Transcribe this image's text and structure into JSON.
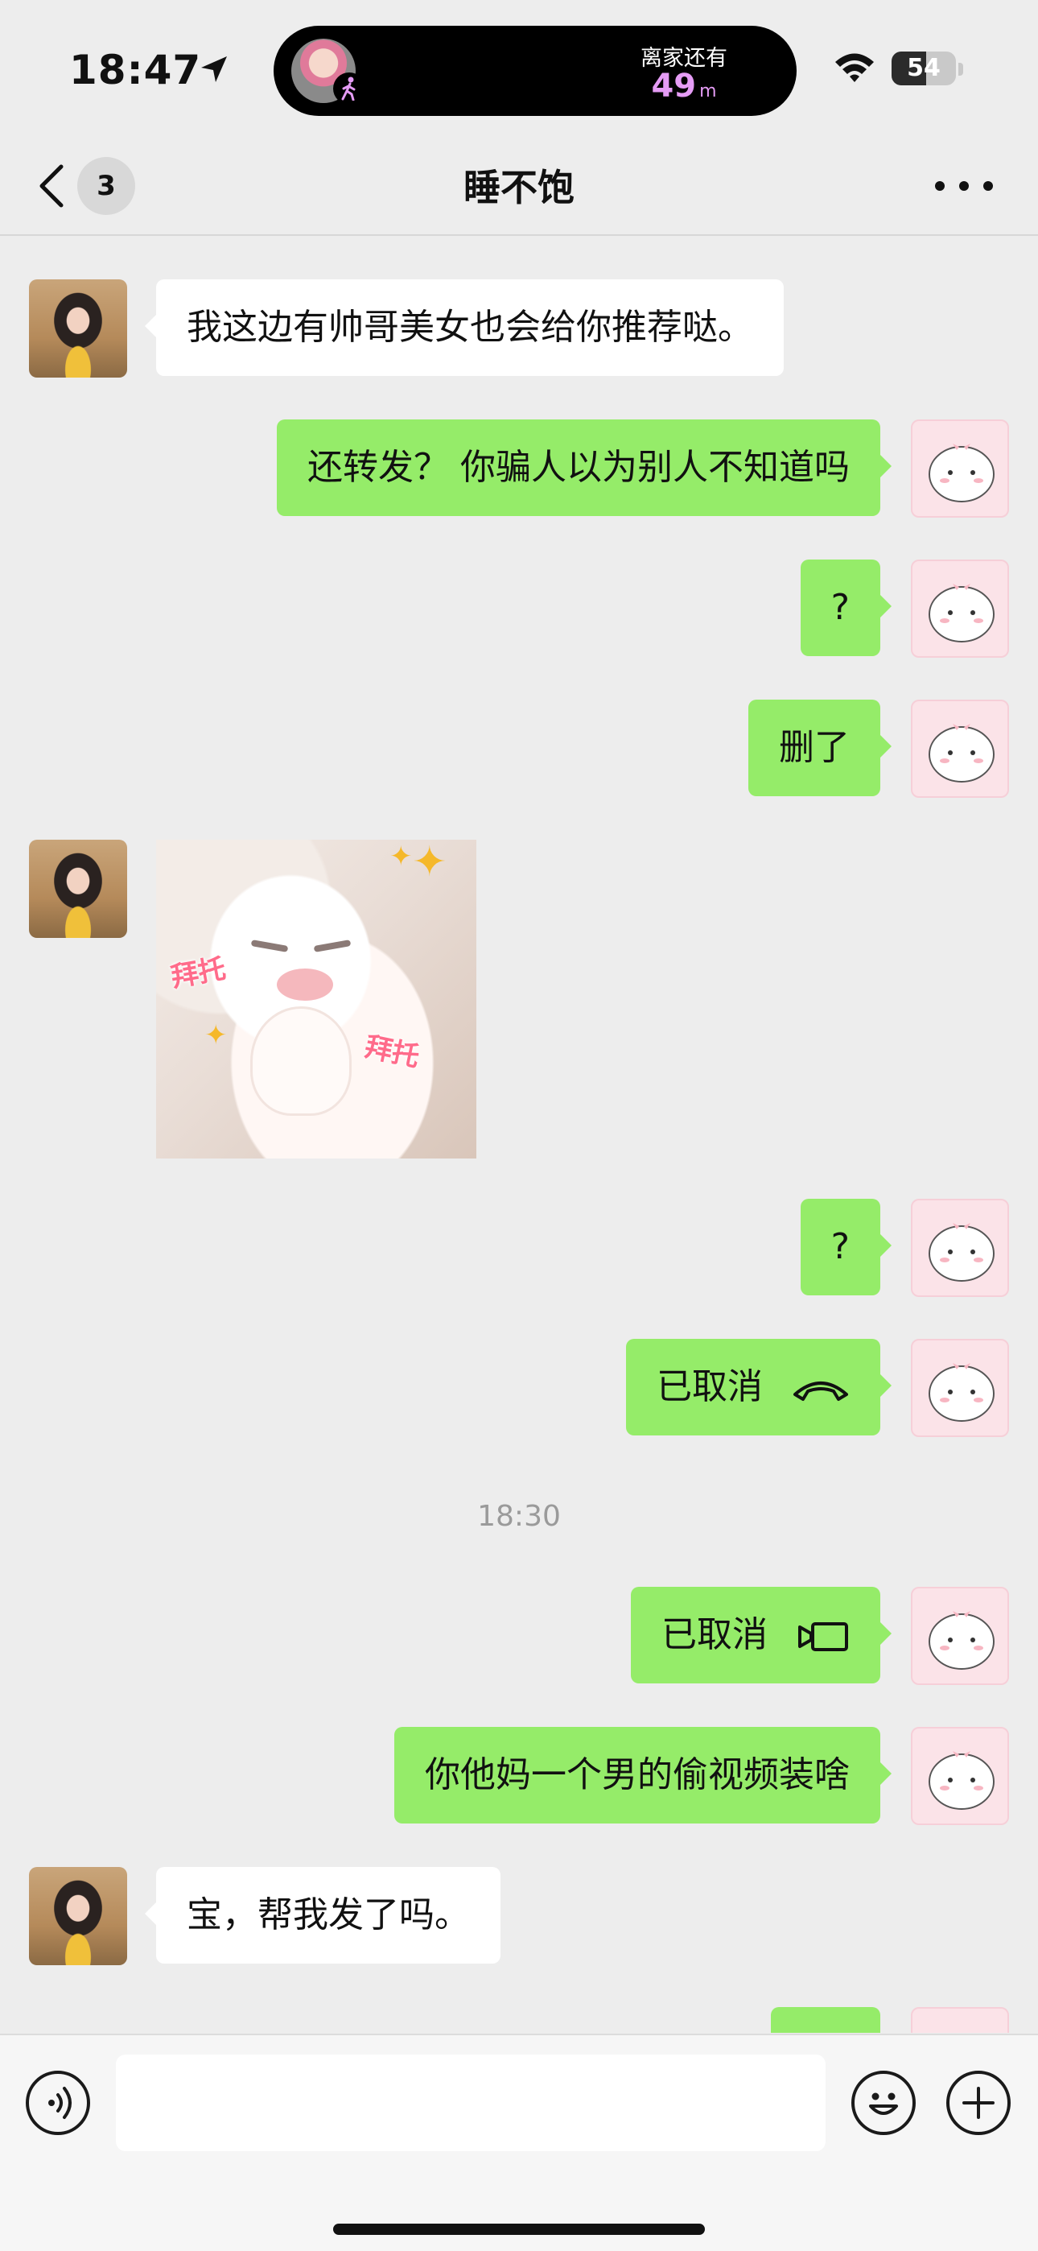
{
  "status_bar": {
    "time": "18:47",
    "live_activity": {
      "label": "离家还有",
      "distance": "49",
      "unit": "m"
    },
    "battery_level": "54"
  },
  "nav": {
    "unread_count": "3",
    "title": "睡不饱"
  },
  "messages": [
    {
      "side": "in",
      "type": "text",
      "text": "我这边有帅哥美女也会给你推荐哒。"
    },
    {
      "side": "out",
      "type": "text",
      "text": "还转发？ 你骗人以为别人不知道吗"
    },
    {
      "side": "out",
      "type": "text",
      "text": "?"
    },
    {
      "side": "out",
      "type": "text",
      "text": "删了"
    },
    {
      "side": "in",
      "type": "sticker",
      "sticker_text": "拜托"
    },
    {
      "side": "out",
      "type": "text",
      "text": "?"
    },
    {
      "side": "out",
      "type": "voice-call",
      "text": "已取消"
    },
    {
      "type": "timestamp",
      "text": "18:30"
    },
    {
      "side": "out",
      "type": "video-call",
      "text": "已取消"
    },
    {
      "side": "out",
      "type": "text",
      "text": "你他妈一个男的偷视频装啥"
    },
    {
      "side": "in",
      "type": "text",
      "text": "宝，帮我发了吗。"
    }
  ],
  "colors": {
    "outgoing_bubble": "#95EC69",
    "incoming_bubble": "#FFFFFF",
    "background": "#EDEDED",
    "island_distance": "#E59CF5"
  },
  "icons": {
    "status": [
      "location-arrow-icon",
      "walking-person-icon",
      "wifi-icon",
      "battery-icon"
    ],
    "nav": [
      "chevron-left-icon",
      "more-dots-icon"
    ],
    "input": [
      "voice-icon",
      "emoji-icon",
      "plus-icon"
    ],
    "calls": [
      "phone-hangup-icon",
      "video-camera-icon"
    ]
  }
}
